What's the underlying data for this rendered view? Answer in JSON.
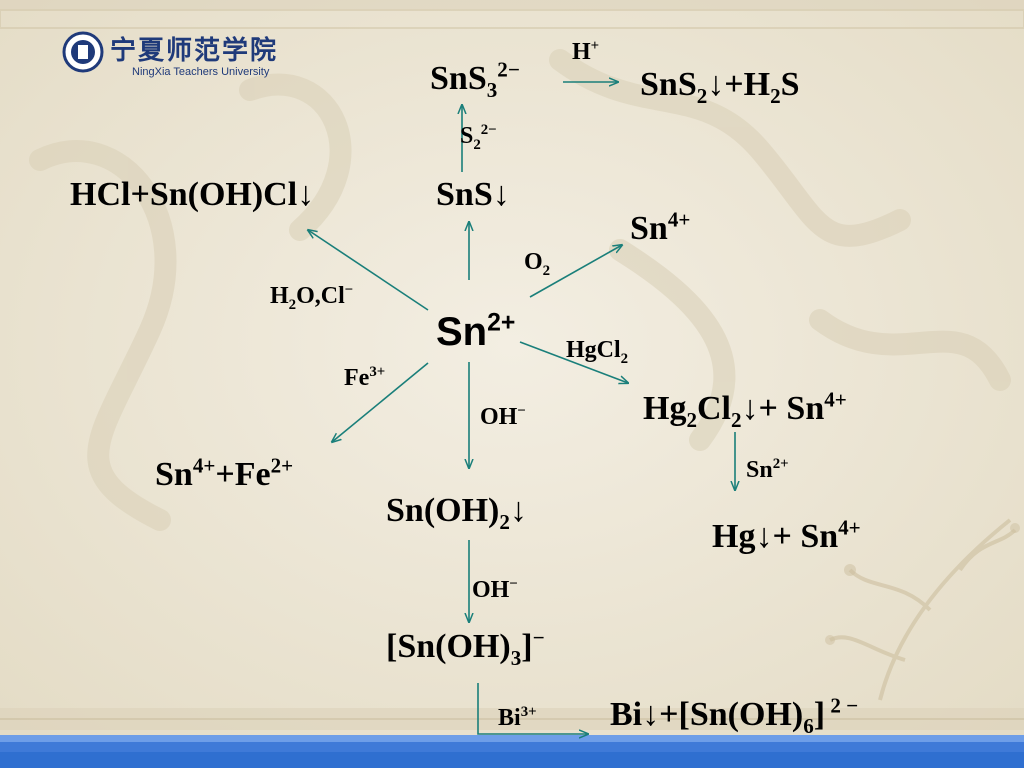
{
  "logo": {
    "chinese_text": "宁夏师范学院",
    "english_text": "NingXia Teachers University"
  },
  "center": {
    "symbol": "Sn",
    "charge": "2+"
  },
  "labels": {
    "sns3_main": "SnS",
    "sns3_sub": "3",
    "sns3_sup": "2−",
    "h_plus_main": "H",
    "h_plus_sup": "+",
    "sns2_a": "SnS",
    "sns2_sub": "2",
    "sns2_b": "↓+H",
    "sns2_sub2": "2",
    "sns2_c": "S",
    "s2_main": "S",
    "s2_sub": "2",
    "s2_sup": "2−",
    "sns": "SnS↓",
    "hcl": "HCl+Sn(OH)Cl↓",
    "sn4_main": "Sn",
    "sn4_sup": "4+",
    "o2_main": "O",
    "o2_sub": "2",
    "h2o_a": "H",
    "h2o_sub": "2",
    "h2o_b": "O,Cl",
    "h2o_sup": "−",
    "hgcl2_main": "HgCl",
    "hgcl2_sub": "2",
    "fe3_main": "Fe",
    "fe3_sup": "3+",
    "hg2cl2_a": "Hg",
    "hg2cl2_sub1": "2",
    "hg2cl2_b": "Cl",
    "hg2cl2_sub2": "2",
    "hg2cl2_c": "↓+ Sn",
    "hg2cl2_sup": "4+",
    "oh1_main": "OH",
    "oh1_sup": "−",
    "snfe_a": "Sn",
    "snfe_sup1": "4+",
    "snfe_b": "+Fe",
    "snfe_sup2": "2+",
    "sn2_reagent_main": "Sn",
    "sn2_reagent_sup": "2+",
    "snoh2_a": "Sn(OH)",
    "snoh2_sub": "2",
    "snoh2_b": "↓",
    "hg_a": "Hg↓+ Sn",
    "hg_sup": "4+",
    "oh2_main": "OH",
    "oh2_sup": "−",
    "snoh3_a": "[Sn(OH)",
    "snoh3_sub": "3",
    "snoh3_b": "]",
    "snoh3_sup": "−",
    "bi3_main": "Bi",
    "bi3_sup": "3+",
    "bi_a": "Bi↓+[Sn(OH)",
    "bi_sub": "6",
    "bi_b": "]",
    "bi_sup": " 2 −"
  },
  "colors": {
    "arrow": "#1a7f7a",
    "background": "#efe9da",
    "logo_blue": "#1f3a7a",
    "band_blue": "#2f6fd0"
  }
}
